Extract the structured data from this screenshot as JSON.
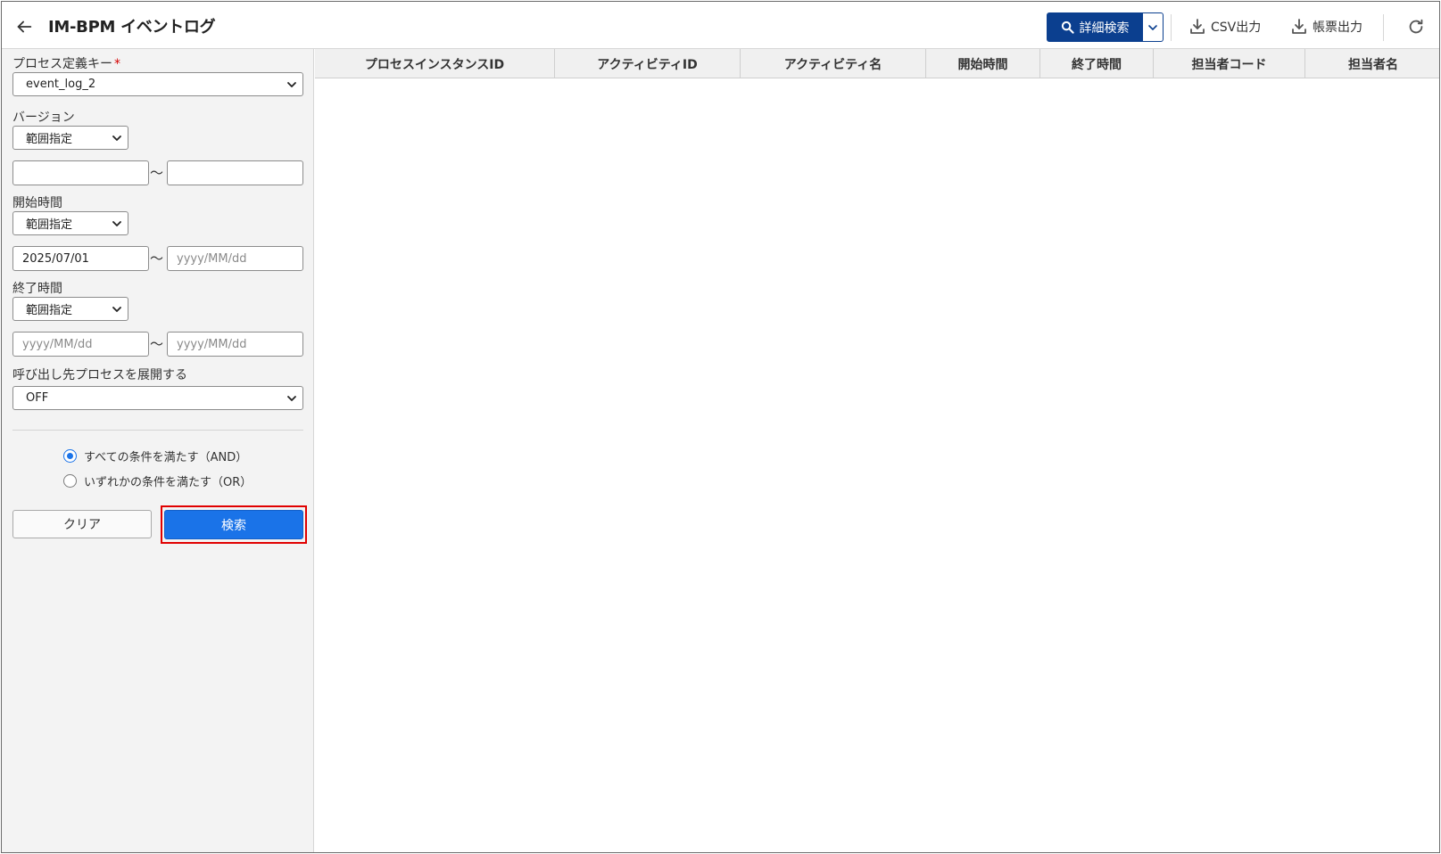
{
  "header": {
    "title": "IM-BPM イベントログ",
    "detail_search_label": "詳細検索",
    "csv_label": "CSV出力",
    "report_label": "帳票出力",
    "accent_color": "#0b3f8f"
  },
  "sidebar": {
    "process_key": {
      "label": "プロセス定義キー",
      "required_mark": "*",
      "value": "event_log_2"
    },
    "version": {
      "label": "バージョン",
      "mode": "範囲指定",
      "from": "",
      "to": ""
    },
    "start_time": {
      "label": "開始時間",
      "mode": "範囲指定",
      "from": "2025/07/01",
      "to_placeholder": "yyyy/MM/dd"
    },
    "end_time": {
      "label": "終了時間",
      "mode": "範囲指定",
      "from_placeholder": "yyyy/MM/dd",
      "to_placeholder": "yyyy/MM/dd"
    },
    "expand_called": {
      "label": "呼び出し先プロセスを展開する",
      "value": "OFF"
    },
    "range_sep": "～",
    "conditions": [
      {
        "label": "すべての条件を満たす（AND）",
        "checked": true
      },
      {
        "label": "いずれかの条件を満たす（OR）",
        "checked": false
      }
    ],
    "clear_label": "クリア",
    "search_label": "検索"
  },
  "table": {
    "columns": [
      "プロセスインスタンスID",
      "アクティビティID",
      "アクティビティ名",
      "開始時間",
      "終了時間",
      "担当者コード",
      "担当者名"
    ]
  }
}
